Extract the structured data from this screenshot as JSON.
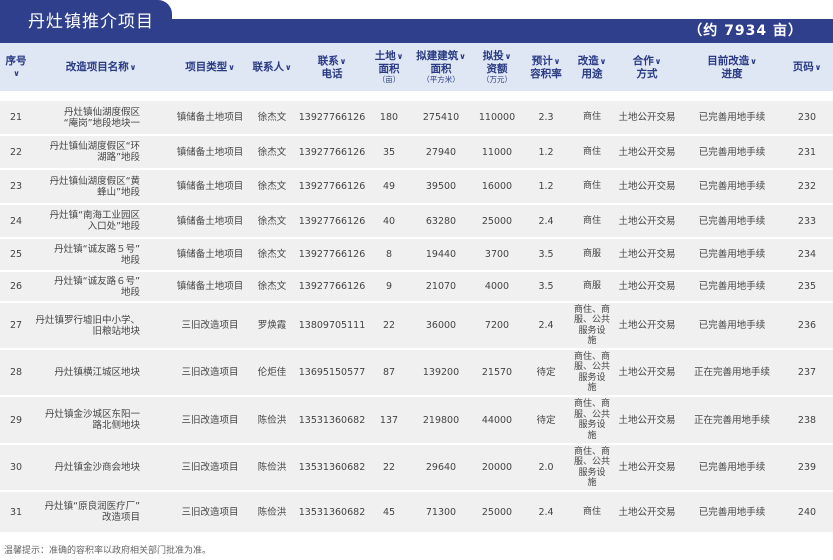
{
  "page_title": "丹灶镇推介项目",
  "total_area": "（约 7934 亩）",
  "columns": [
    {
      "key": "seq",
      "label": "序号",
      "sub": "",
      "chev": true
    },
    {
      "key": "name",
      "label": "改造项目名称",
      "sub": "",
      "chev": true
    },
    {
      "key": "type",
      "label": "项目类型",
      "sub": "",
      "chev": true
    },
    {
      "key": "contact",
      "label": "联系人",
      "sub": "",
      "chev": true
    },
    {
      "key": "phone",
      "label": "联系\n电话",
      "sub": "",
      "chev": true
    },
    {
      "key": "land",
      "label": "土地\n面积",
      "sub": "（亩）",
      "chev": true
    },
    {
      "key": "build",
      "label": "拟建建筑\n面积",
      "sub": "（平方米）",
      "chev": true
    },
    {
      "key": "invest",
      "label": "拟投\n资额",
      "sub": "（万元）",
      "chev": true
    },
    {
      "key": "far",
      "label": "预计\n容积率",
      "sub": "",
      "chev": true
    },
    {
      "key": "use",
      "label": "改造\n用途",
      "sub": "",
      "chev": true
    },
    {
      "key": "coop",
      "label": "合作\n方式",
      "sub": "",
      "chev": true
    },
    {
      "key": "progress",
      "label": "目前改造\n进度",
      "sub": "",
      "chev": true
    },
    {
      "key": "page",
      "label": "页码",
      "sub": "",
      "chev": true
    }
  ],
  "rows": [
    {
      "seq": "21",
      "name": "丹灶镇仙湖度假区\n“庵岗”地段地块一",
      "type": "镇储备土地项目",
      "contact": "徐杰文",
      "phone": "13927766126",
      "land": "180",
      "build": "275410",
      "invest": "110000",
      "far": "2.3",
      "use": "商住",
      "coop": "土地公开交易",
      "progress": "已完善用地手续",
      "page": "230"
    },
    {
      "seq": "22",
      "name": "丹灶镇仙湖度假区“环\n湖路”地段",
      "type": "镇储备土地项目",
      "contact": "徐杰文",
      "phone": "13927766126",
      "land": "35",
      "build": "27940",
      "invest": "11000",
      "far": "1.2",
      "use": "商住",
      "coop": "土地公开交易",
      "progress": "已完善用地手续",
      "page": "231"
    },
    {
      "seq": "23",
      "name": "丹灶镇仙湖度假区“黄\n蜂山”地段",
      "type": "镇储备土地项目",
      "contact": "徐杰文",
      "phone": "13927766126",
      "land": "49",
      "build": "39500",
      "invest": "16000",
      "far": "1.2",
      "use": "商住",
      "coop": "土地公开交易",
      "progress": "已完善用地手续",
      "page": "232"
    },
    {
      "seq": "24",
      "name": "丹灶镇“南海工业园区\n入口处”地段",
      "type": "镇储备土地项目",
      "contact": "徐杰文",
      "phone": "13927766126",
      "land": "40",
      "build": "63280",
      "invest": "25000",
      "far": "2.4",
      "use": "商住",
      "coop": "土地公开交易",
      "progress": "已完善用地手续",
      "page": "233"
    },
    {
      "seq": "25",
      "name": "丹灶镇“诚友路５号”\n地段",
      "type": "镇储备土地项目",
      "contact": "徐杰文",
      "phone": "13927766126",
      "land": "8",
      "build": "19440",
      "invest": "3700",
      "far": "3.5",
      "use": "商服",
      "coop": "土地公开交易",
      "progress": "已完善用地手续",
      "page": "234"
    },
    {
      "seq": "26",
      "name": "丹灶镇“诚友路６号”\n地段",
      "type": "镇储备土地项目",
      "contact": "徐杰文",
      "phone": "13927766126",
      "land": "9",
      "build": "21070",
      "invest": "4000",
      "far": "3.5",
      "use": "商服",
      "coop": "土地公开交易",
      "progress": "已完善用地手续",
      "page": "235"
    },
    {
      "seq": "27",
      "name": "丹灶镇罗行墟旧中小学、\n旧粮站地块",
      "type": "三旧改造项目",
      "contact": "罗焕霞",
      "phone": "13809705111",
      "land": "22",
      "build": "36000",
      "invest": "7200",
      "far": "2.4",
      "use": "商住、商\n服、公共\n服务设\n施",
      "coop": "土地公开交易",
      "progress": "已完善用地手续",
      "page": "236"
    },
    {
      "seq": "28",
      "name": "丹灶镇横江城区地块",
      "type": "三旧改造项目",
      "contact": "伦炬佳",
      "phone": "13695150577",
      "land": "87",
      "build": "139200",
      "invest": "21570",
      "far": "待定",
      "use": "商住、商\n服、公共\n服务设\n施",
      "coop": "土地公开交易",
      "progress": "正在完善用地手续",
      "page": "237"
    },
    {
      "seq": "29",
      "name": "丹灶镇金沙城区东阳一\n路北侧地块",
      "type": "三旧改造项目",
      "contact": "陈俭洪",
      "phone": "13531360682",
      "land": "137",
      "build": "219800",
      "invest": "44000",
      "far": "待定",
      "use": "商住、商\n服、公共\n服务设\n施",
      "coop": "土地公开交易",
      "progress": "正在完善用地手续",
      "page": "238"
    },
    {
      "seq": "30",
      "name": "丹灶镇金沙商会地块",
      "type": "三旧改造项目",
      "contact": "陈俭洪",
      "phone": "13531360682",
      "land": "22",
      "build": "29640",
      "invest": "20000",
      "far": "2.0",
      "use": "商住、商\n服、公共\n服务设\n施",
      "coop": "土地公开交易",
      "progress": "已完善用地手续",
      "page": "239"
    },
    {
      "seq": "31",
      "name": "丹灶镇“原良润医疗厂”\n改造项目",
      "type": "三旧改造项目",
      "contact": "陈俭洪",
      "phone": "13531360682",
      "land": "45",
      "build": "71300",
      "invest": "25000",
      "far": "2.4",
      "use": "商住",
      "coop": "土地公开交易",
      "progress": "已完善用地手续",
      "page": "240"
    }
  ],
  "footer_note": "温馨提示：准确的容积率以政府相关部门批准为准。",
  "colors": {
    "brand": "#2f3f8c",
    "header_bg": "#dfe6f4",
    "row_bg": "#f0f0f0",
    "header_text": "#2a3a84"
  }
}
